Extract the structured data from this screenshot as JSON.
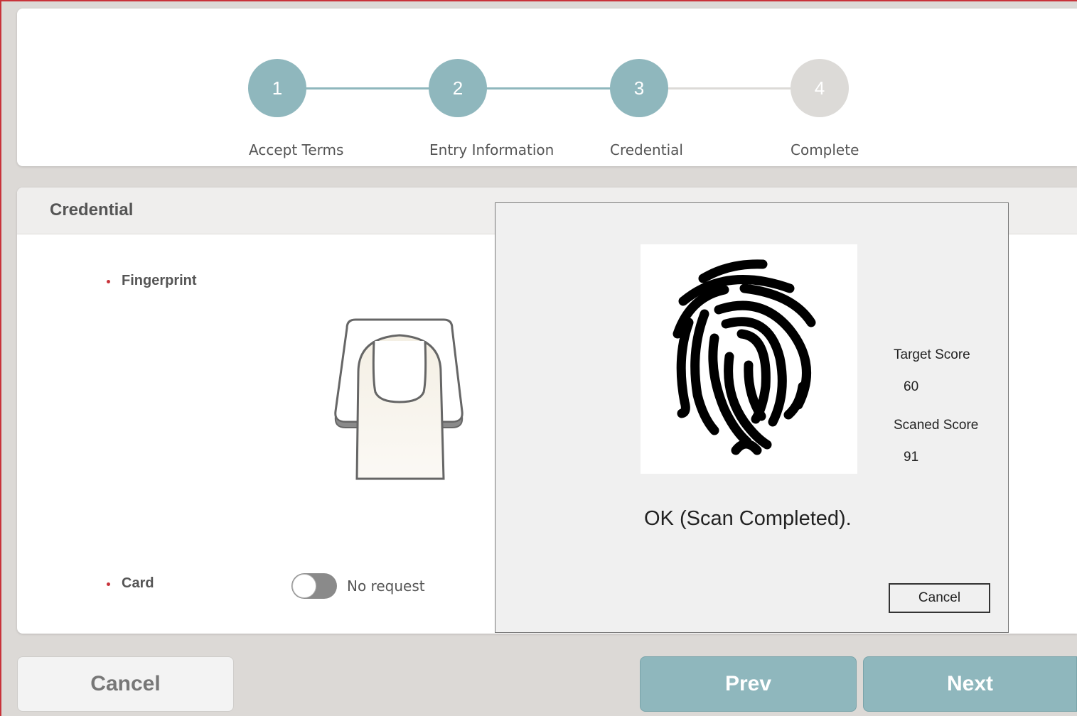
{
  "stepper": {
    "steps": [
      {
        "number": "1",
        "label": "Accept Terms",
        "state": "done"
      },
      {
        "number": "2",
        "label": "Entry Information",
        "state": "done"
      },
      {
        "number": "3",
        "label": "Credential",
        "state": "current"
      },
      {
        "number": "4",
        "label": "Complete",
        "state": "pending"
      }
    ]
  },
  "credential": {
    "title": "Credential",
    "fingerprint_label": "Fingerprint",
    "card_label": "Card",
    "card_toggle_text": "No request"
  },
  "scan_dialog": {
    "target_score_label": "Target Score",
    "target_score_value": "60",
    "scanned_score_label": "Scaned Score",
    "scanned_score_value": "91",
    "status": "OK (Scan Completed).",
    "cancel_label": "Cancel"
  },
  "footer": {
    "cancel_label": "Cancel",
    "prev_label": "Prev",
    "next_label": "Next"
  },
  "colors": {
    "accent": "#8fb7bd",
    "inactive": "#dcdad7",
    "bullet": "#c8333a"
  }
}
